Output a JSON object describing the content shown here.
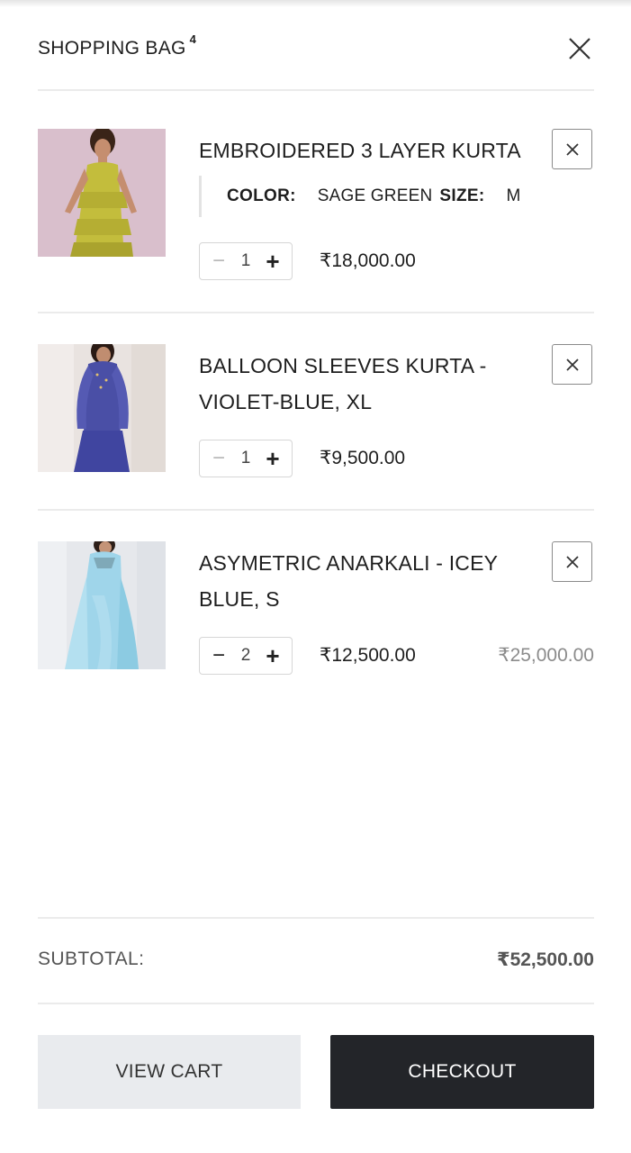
{
  "header": {
    "title": "SHOPPING BAG",
    "count": "4"
  },
  "items": [
    {
      "name": "EMBROIDERED 3 LAYER KURTA",
      "options": [
        {
          "label": "COLOR:",
          "value": "SAGE GREEN"
        },
        {
          "label": "SIZE:",
          "value": "M"
        }
      ],
      "quantity": "1",
      "price": "₹18,000.00",
      "original_price": ""
    },
    {
      "name": "BALLOON SLEEVES KURTA - VIOLET-BLUE, XL",
      "quantity": "1",
      "price": "₹9,500.00",
      "original_price": ""
    },
    {
      "name": "ASYMETRIC ANARKALI - ICEY BLUE, S",
      "quantity": "2",
      "price": "₹12,500.00",
      "original_price": "₹25,000.00"
    }
  ],
  "footer": {
    "subtotal_label": "SUBTOTAL:",
    "subtotal_value": "₹52,500.00",
    "view_cart_label": "VIEW CART",
    "checkout_label": "CHECKOUT"
  },
  "icons": {
    "close": "close-icon",
    "remove": "close-icon",
    "minus": "minus-icon",
    "plus": "plus-icon"
  },
  "colors": {
    "checkout_bg": "#232529",
    "view_cart_bg": "#e9ebee",
    "divider": "#ebebeb",
    "product_1": "#c4be3e",
    "product_2": "#4a4fa6",
    "product_3": "#9fd5ea"
  }
}
